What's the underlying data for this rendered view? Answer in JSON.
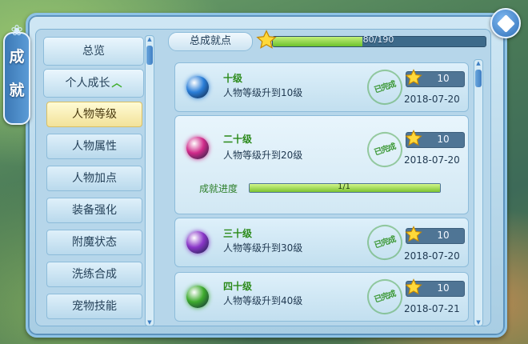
{
  "window": {
    "title_chars": [
      "成",
      "就"
    ]
  },
  "sidebar": {
    "overview": "总览",
    "growth": {
      "label": "个人成长",
      "expanded": true
    },
    "items": [
      {
        "label": "人物等级",
        "active": true
      },
      {
        "label": "人物属性",
        "active": false
      },
      {
        "label": "人物加点",
        "active": false
      },
      {
        "label": "装备强化",
        "active": false
      },
      {
        "label": "附魔状态",
        "active": false
      },
      {
        "label": "洗练合成",
        "active": false
      },
      {
        "label": "宠物技能",
        "active": false
      }
    ]
  },
  "header": {
    "label": "总成就点",
    "progress_text": "80/190",
    "progress_value": 80,
    "progress_max": 190
  },
  "achievements": [
    {
      "title": "十级",
      "desc": "人物等级升到10级",
      "points": "10",
      "date": "2018-07-20",
      "stamp": "已完成",
      "gem_color": "#2a7ed8"
    },
    {
      "title": "二十级",
      "desc": "人物等级升到20级",
      "points": "10",
      "date": "2018-07-20",
      "stamp": "已完成",
      "gem_color": "#d02a8a",
      "progress": {
        "label": "成就进度",
        "text": "1/1",
        "value": 1,
        "max": 1
      }
    },
    {
      "title": "三十级",
      "desc": "人物等级升到30级",
      "points": "10",
      "date": "2018-07-20",
      "stamp": "已完成",
      "gem_color": "#8a36c8"
    },
    {
      "title": "四十级",
      "desc": "人物等级升到40级",
      "points": "10",
      "date": "2018-07-21",
      "stamp": "已完成",
      "gem_color": "#3eab2e"
    }
  ],
  "colors": {
    "accent_green": "#2b8a1a",
    "frame_blue": "#8ec3e6",
    "active_tab": "#f2e29a"
  }
}
